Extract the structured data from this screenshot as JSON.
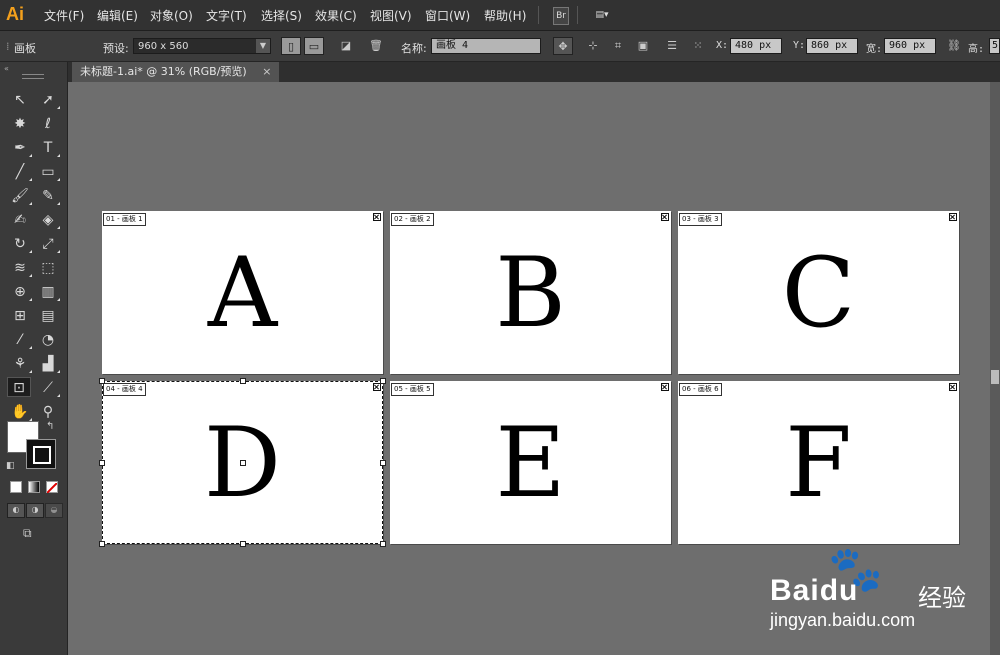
{
  "app": {
    "logo": "Ai"
  },
  "menu": {
    "items": [
      "文件(F)",
      "编辑(E)",
      "对象(O)",
      "文字(T)",
      "选择(S)",
      "效果(C)",
      "视图(V)",
      "窗口(W)",
      "帮助(H)"
    ],
    "bridge_label": "Br",
    "arrange_label": "▤▾"
  },
  "control": {
    "artboard_label": "画板",
    "preset_label": "预设:",
    "preset_value": "960 x 560",
    "name_label": "名称:",
    "name_value": "画板 4",
    "x_label": "X:",
    "x_value": "480 px",
    "y_label": "Y:",
    "y_value": "860 px",
    "w_label": "宽:",
    "w_value": "960 px",
    "h_label": "高:",
    "h_value": "5"
  },
  "document": {
    "tab_title": "未标题-1.ai* @ 31% (RGB/预览)",
    "close_glyph": "×"
  },
  "artboards": [
    {
      "label": "01 - 画板 1",
      "letter": "A",
      "selected": false
    },
    {
      "label": "02 - 画板 2",
      "letter": "B",
      "selected": false
    },
    {
      "label": "03 - 画板 3",
      "letter": "C",
      "selected": false
    },
    {
      "label": "04 - 画板 4",
      "letter": "D",
      "selected": true
    },
    {
      "label": "05 - 画板 5",
      "letter": "E",
      "selected": false
    },
    {
      "label": "06 - 画板 6",
      "letter": "F",
      "selected": false
    }
  ],
  "watermark": {
    "brand": "Bai",
    "brand_suffix": "du",
    "brand_cn": "经验",
    "url": "jingyan.baidu.com"
  },
  "colors": {
    "accent": "#f4a01c",
    "canvas": "#6e6e6e",
    "panel": "#3a3a3a"
  }
}
